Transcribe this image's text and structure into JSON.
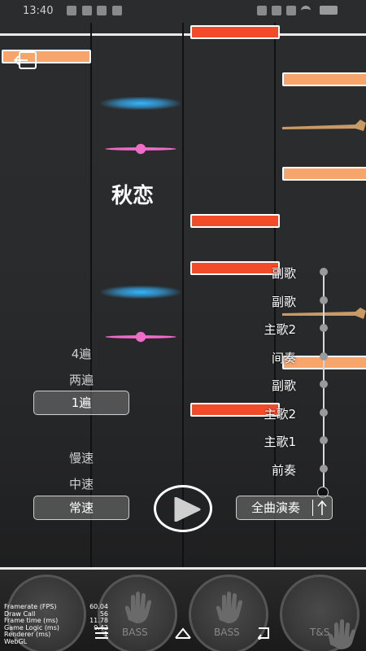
{
  "status_bar": {
    "time": "13:40"
  },
  "song": {
    "title": "秋恋"
  },
  "sections": [
    "副歌",
    "副歌",
    "主歌2",
    "间奏",
    "副歌",
    "主歌2",
    "主歌1",
    "前奏"
  ],
  "repeat": {
    "options": [
      "4遍",
      "两遍",
      "1遍"
    ],
    "selected": "1遍"
  },
  "speed": {
    "options": [
      "慢速",
      "中速",
      "常速"
    ],
    "selected": "常速"
  },
  "full_song_button": {
    "label": "全曲演奏"
  },
  "drums": {
    "labels": [
      "BASS",
      "BASS",
      "T&S"
    ]
  },
  "stats": [
    {
      "label": "Framerate (FPS)",
      "value": "60.04"
    },
    {
      "label": "Draw Call",
      "value": "56"
    },
    {
      "label": "Frame time (ms)",
      "value": "11.78"
    },
    {
      "label": "Game Logic (ms)",
      "value": "0.42"
    },
    {
      "label": "Renderer (ms)",
      "value": "1"
    },
    {
      "label": "WebGL",
      "value": ""
    }
  ],
  "colors": {
    "note_red": "#f24b2a",
    "note_orange": "#f7a56a",
    "note_blue": "#35b6ff",
    "note_pink": "#f06cc8",
    "arrow_brown": "#c99a63"
  },
  "icons": {
    "exit": "exit-icon",
    "play": "play-icon"
  }
}
